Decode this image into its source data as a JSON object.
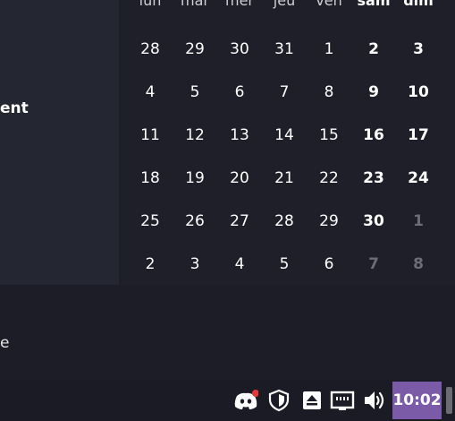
{
  "left_panel": {
    "partial_heading": "ent",
    "partial_text": "e"
  },
  "calendar": {
    "weekdays": [
      "lun",
      "mar",
      "mer",
      "jeu",
      "ven",
      "sam",
      "dim"
    ],
    "weeks": [
      [
        "28",
        "29",
        "30",
        "31",
        "1",
        "2",
        "3"
      ],
      [
        "4",
        "5",
        "6",
        "7",
        "8",
        "9",
        "10"
      ],
      [
        "11",
        "12",
        "13",
        "14",
        "15",
        "16",
        "17"
      ],
      [
        "18",
        "19",
        "20",
        "21",
        "22",
        "23",
        "24"
      ],
      [
        "25",
        "26",
        "27",
        "28",
        "29",
        "30",
        "1"
      ],
      [
        "2",
        "3",
        "4",
        "5",
        "6",
        "7",
        "8"
      ]
    ]
  },
  "taskbar": {
    "icons": [
      "discord-icon",
      "shield-icon",
      "eject-icon",
      "network-icon",
      "volume-icon"
    ],
    "notification_color": "#e53935",
    "clock": "10:02",
    "clock_bg": "#7b5aa8"
  }
}
